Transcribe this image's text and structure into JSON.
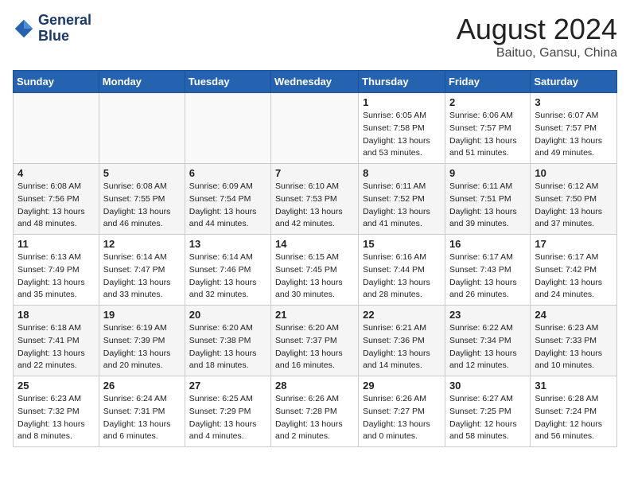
{
  "header": {
    "logo_line1": "General",
    "logo_line2": "Blue",
    "month": "August 2024",
    "location": "Baituo, Gansu, China"
  },
  "weekdays": [
    "Sunday",
    "Monday",
    "Tuesday",
    "Wednesday",
    "Thursday",
    "Friday",
    "Saturday"
  ],
  "weeks": [
    [
      {
        "day": "",
        "info": ""
      },
      {
        "day": "",
        "info": ""
      },
      {
        "day": "",
        "info": ""
      },
      {
        "day": "",
        "info": ""
      },
      {
        "day": "1",
        "info": "Sunrise: 6:05 AM\nSunset: 7:58 PM\nDaylight: 13 hours\nand 53 minutes."
      },
      {
        "day": "2",
        "info": "Sunrise: 6:06 AM\nSunset: 7:57 PM\nDaylight: 13 hours\nand 51 minutes."
      },
      {
        "day": "3",
        "info": "Sunrise: 6:07 AM\nSunset: 7:57 PM\nDaylight: 13 hours\nand 49 minutes."
      }
    ],
    [
      {
        "day": "4",
        "info": "Sunrise: 6:08 AM\nSunset: 7:56 PM\nDaylight: 13 hours\nand 48 minutes."
      },
      {
        "day": "5",
        "info": "Sunrise: 6:08 AM\nSunset: 7:55 PM\nDaylight: 13 hours\nand 46 minutes."
      },
      {
        "day": "6",
        "info": "Sunrise: 6:09 AM\nSunset: 7:54 PM\nDaylight: 13 hours\nand 44 minutes."
      },
      {
        "day": "7",
        "info": "Sunrise: 6:10 AM\nSunset: 7:53 PM\nDaylight: 13 hours\nand 42 minutes."
      },
      {
        "day": "8",
        "info": "Sunrise: 6:11 AM\nSunset: 7:52 PM\nDaylight: 13 hours\nand 41 minutes."
      },
      {
        "day": "9",
        "info": "Sunrise: 6:11 AM\nSunset: 7:51 PM\nDaylight: 13 hours\nand 39 minutes."
      },
      {
        "day": "10",
        "info": "Sunrise: 6:12 AM\nSunset: 7:50 PM\nDaylight: 13 hours\nand 37 minutes."
      }
    ],
    [
      {
        "day": "11",
        "info": "Sunrise: 6:13 AM\nSunset: 7:49 PM\nDaylight: 13 hours\nand 35 minutes."
      },
      {
        "day": "12",
        "info": "Sunrise: 6:14 AM\nSunset: 7:47 PM\nDaylight: 13 hours\nand 33 minutes."
      },
      {
        "day": "13",
        "info": "Sunrise: 6:14 AM\nSunset: 7:46 PM\nDaylight: 13 hours\nand 32 minutes."
      },
      {
        "day": "14",
        "info": "Sunrise: 6:15 AM\nSunset: 7:45 PM\nDaylight: 13 hours\nand 30 minutes."
      },
      {
        "day": "15",
        "info": "Sunrise: 6:16 AM\nSunset: 7:44 PM\nDaylight: 13 hours\nand 28 minutes."
      },
      {
        "day": "16",
        "info": "Sunrise: 6:17 AM\nSunset: 7:43 PM\nDaylight: 13 hours\nand 26 minutes."
      },
      {
        "day": "17",
        "info": "Sunrise: 6:17 AM\nSunset: 7:42 PM\nDaylight: 13 hours\nand 24 minutes."
      }
    ],
    [
      {
        "day": "18",
        "info": "Sunrise: 6:18 AM\nSunset: 7:41 PM\nDaylight: 13 hours\nand 22 minutes."
      },
      {
        "day": "19",
        "info": "Sunrise: 6:19 AM\nSunset: 7:39 PM\nDaylight: 13 hours\nand 20 minutes."
      },
      {
        "day": "20",
        "info": "Sunrise: 6:20 AM\nSunset: 7:38 PM\nDaylight: 13 hours\nand 18 minutes."
      },
      {
        "day": "21",
        "info": "Sunrise: 6:20 AM\nSunset: 7:37 PM\nDaylight: 13 hours\nand 16 minutes."
      },
      {
        "day": "22",
        "info": "Sunrise: 6:21 AM\nSunset: 7:36 PM\nDaylight: 13 hours\nand 14 minutes."
      },
      {
        "day": "23",
        "info": "Sunrise: 6:22 AM\nSunset: 7:34 PM\nDaylight: 13 hours\nand 12 minutes."
      },
      {
        "day": "24",
        "info": "Sunrise: 6:23 AM\nSunset: 7:33 PM\nDaylight: 13 hours\nand 10 minutes."
      }
    ],
    [
      {
        "day": "25",
        "info": "Sunrise: 6:23 AM\nSunset: 7:32 PM\nDaylight: 13 hours\nand 8 minutes."
      },
      {
        "day": "26",
        "info": "Sunrise: 6:24 AM\nSunset: 7:31 PM\nDaylight: 13 hours\nand 6 minutes."
      },
      {
        "day": "27",
        "info": "Sunrise: 6:25 AM\nSunset: 7:29 PM\nDaylight: 13 hours\nand 4 minutes."
      },
      {
        "day": "28",
        "info": "Sunrise: 6:26 AM\nSunset: 7:28 PM\nDaylight: 13 hours\nand 2 minutes."
      },
      {
        "day": "29",
        "info": "Sunrise: 6:26 AM\nSunset: 7:27 PM\nDaylight: 13 hours\nand 0 minutes."
      },
      {
        "day": "30",
        "info": "Sunrise: 6:27 AM\nSunset: 7:25 PM\nDaylight: 12 hours\nand 58 minutes."
      },
      {
        "day": "31",
        "info": "Sunrise: 6:28 AM\nSunset: 7:24 PM\nDaylight: 12 hours\nand 56 minutes."
      }
    ]
  ]
}
